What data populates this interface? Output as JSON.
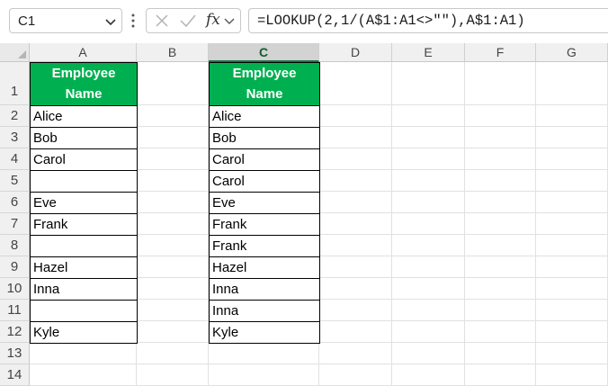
{
  "formula_bar": {
    "name_box": "C1",
    "fx_label": "fx",
    "formula": "=LOOKUP(2,1/(A$1:A1<>\"\"),A$1:A1)"
  },
  "columns": [
    "A",
    "B",
    "C",
    "D",
    "E",
    "F",
    "G"
  ],
  "active_column": "C",
  "rows": [
    "1",
    "2",
    "3",
    "4",
    "5",
    "6",
    "7",
    "8",
    "9",
    "10",
    "11",
    "12",
    "13",
    "14"
  ],
  "table_a": {
    "header": "Employee Name",
    "cells": [
      "Alice",
      "Bob",
      "Carol",
      "",
      "Eve",
      "Frank",
      "",
      "Hazel",
      "Inna",
      "",
      "Kyle"
    ]
  },
  "table_c": {
    "header": "Employee Name",
    "cells": [
      "Alice",
      "Bob",
      "Carol",
      "Carol",
      "Eve",
      "Frank",
      "Frank",
      "Hazel",
      "Inna",
      "Inna",
      "Kyle"
    ]
  },
  "colors": {
    "header_fill": "#00b050",
    "header_text": "#ffffff",
    "selection": "#1e7145"
  },
  "icons": {
    "name_box_dropdown": "chevron-down-icon",
    "more": "vertical-dots-icon",
    "cancel": "close-icon",
    "enter": "check-icon",
    "function": "fx-icon",
    "formula_expand": "chevron-down-icon"
  }
}
